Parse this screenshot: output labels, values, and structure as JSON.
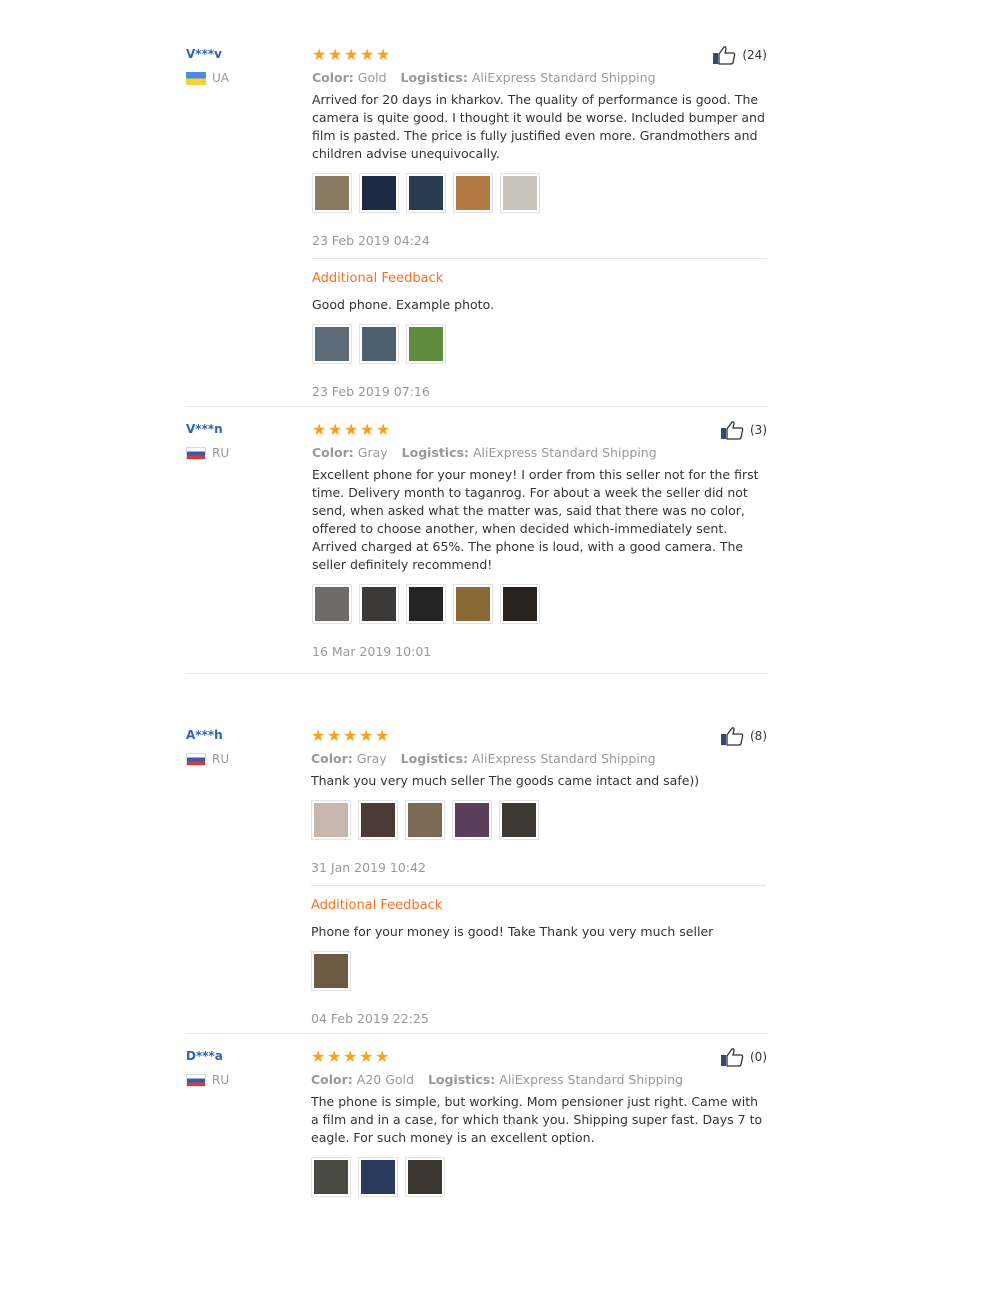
{
  "labels": {
    "color": "Color:",
    "logistics": "Logistics:",
    "additional_feedback": "Additional Feedback"
  },
  "reviews": [
    {
      "name": "V***v",
      "country": "UA",
      "flag": "ua",
      "likes": "(24)",
      "color": "Gold",
      "logistics": "AliExpress Standard Shipping",
      "text": "Arrived for 20 days in kharkov. The quality of performance is good. The camera is quite good. I thought it would be worse. Included bumper and film is pasted. The price is fully justified even more. Grandmothers and children advise unequivocally.",
      "date": "23 Feb 2019 04:24",
      "thumbs": [
        "#8a7a62",
        "#1c2a44",
        "#2a3b4f",
        "#b37a44",
        "#c9c4bb"
      ],
      "additional": {
        "text": "Good phone. Example photo.",
        "date": "23 Feb 2019 07:16",
        "thumbs": [
          "#5d6b78",
          "#4d5f6e",
          "#5f8c3c"
        ]
      }
    },
    {
      "name": "V***n",
      "country": "RU",
      "flag": "ru",
      "likes": "(3)",
      "color": "Gray",
      "logistics": "AliExpress Standard Shipping",
      "text": "Excellent phone for your money! I order from this seller not for the first time. Delivery month to taganrog. For about a week the seller did not send, when asked what the matter was, said that there was no color, offered to choose another, when decided which-immediately sent. Arrived charged at 65%. The phone is loud, with a good camera. The seller definitely recommend!",
      "date": "16 Mar 2019 10:01",
      "thumbs": [
        "#6e6b66",
        "#3b3a38",
        "#242424",
        "#8a6a34",
        "#2a2420"
      ],
      "additional": null
    },
    {
      "name": "A***h",
      "country": "RU",
      "flag": "ru",
      "likes": "(8)",
      "color": "Gray",
      "logistics": "AliExpress Standard Shipping",
      "text": "Thank you very much seller The goods came intact and safe))",
      "date": "31 Jan 2019 10:42",
      "thumbs": [
        "#c7b6ad",
        "#4c3a36",
        "#7a6a55",
        "#5a3d58",
        "#3d3a36"
      ],
      "additional": {
        "text": "Phone for your money is good! Take Thank you very much seller",
        "date": "04 Feb 2019 22:25",
        "thumbs": [
          "#6d5a45"
        ]
      }
    },
    {
      "name": "D***a",
      "country": "RU",
      "flag": "ru",
      "likes": "(0)",
      "color": "A20 Gold",
      "logistics": "AliExpress Standard Shipping",
      "text": "The phone is simple, but working. Mom pensioner just right. Came with a film and in a case, for which thank you. Shipping super fast. Days 7 to eagle. For such money is an excellent option.",
      "date": null,
      "thumbs": [
        "#4a4a44",
        "#2b3a5a",
        "#3a3632"
      ],
      "additional": null
    }
  ]
}
